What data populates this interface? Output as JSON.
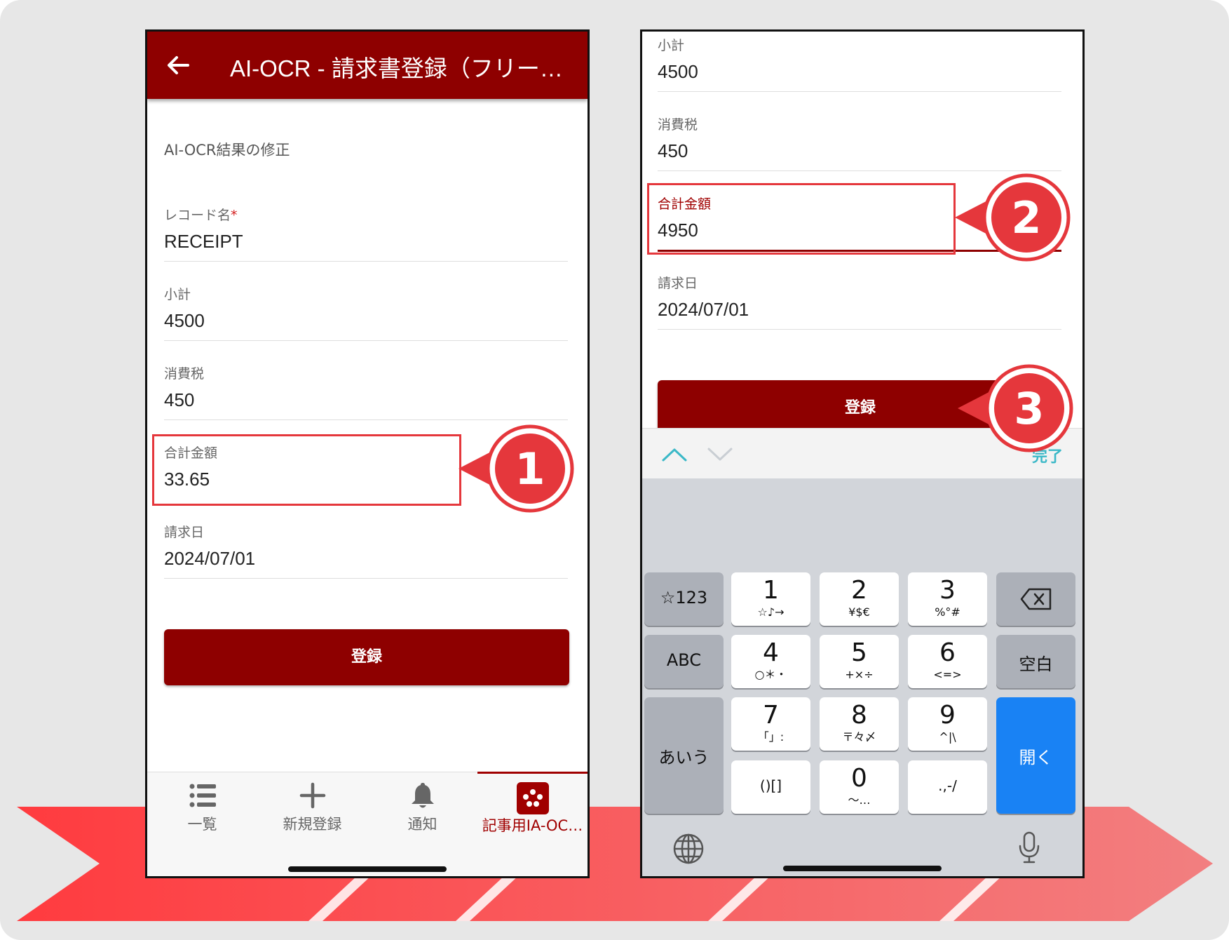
{
  "phone1": {
    "app_title": "AI-OCR - 請求書登録（フリー…",
    "section_title": "AI-OCR結果の修正",
    "fields": [
      {
        "label": "レコード名",
        "required_mark": "*",
        "value": "RECEIPT"
      },
      {
        "label": "小計",
        "value": "4500"
      },
      {
        "label": "消費税",
        "value": "450"
      },
      {
        "label": "合計金額",
        "value": "33.65"
      },
      {
        "label": "請求日",
        "value": "2024/07/01"
      }
    ],
    "submit_label": "登録",
    "tabs": [
      {
        "label": "一覧",
        "icon": "list-icon"
      },
      {
        "label": "新規登録",
        "icon": "plus-icon"
      },
      {
        "label": "通知",
        "icon": "bell-icon"
      },
      {
        "label": "記事用IA-OC…",
        "icon": "app-logo-icon",
        "active": true
      }
    ]
  },
  "phone2": {
    "fields": [
      {
        "label": "小計",
        "value": "4500"
      },
      {
        "label": "消費税",
        "value": "450"
      },
      {
        "label": "合計金額",
        "value": "4950",
        "focused": true
      },
      {
        "label": "請求日",
        "value": "2024/07/01"
      }
    ],
    "submit_label": "登録",
    "keyboard": {
      "done_label": "完了",
      "keys": {
        "sym": "☆123",
        "abc": "ABC",
        "kana": "あいう",
        "space": "空白",
        "open": "開く",
        "k1": {
          "main": "1",
          "sub": "☆♪→"
        },
        "k2": {
          "main": "2",
          "sub": "¥$€"
        },
        "k3": {
          "main": "3",
          "sub": "%°#"
        },
        "k4": {
          "main": "4",
          "sub": "○＊・"
        },
        "k5": {
          "main": "5",
          "sub": "+×÷"
        },
        "k6": {
          "main": "6",
          "sub": "<=>"
        },
        "k7": {
          "main": "7",
          "sub": "「」:"
        },
        "k8": {
          "main": "8",
          "sub": "〒々〆"
        },
        "k9": {
          "main": "9",
          "sub": "^|\\"
        },
        "k0": {
          "main": "0",
          "sub": "〜…"
        },
        "kparen": "()[]",
        "kpunct": ".,-/"
      }
    }
  },
  "steps": [
    "1",
    "2",
    "3"
  ],
  "colors": {
    "brand": "#8e0000",
    "highlight": "#e5373c",
    "keyboard_blue": "#1982f4",
    "accent_teal": "#3ab8c7"
  }
}
